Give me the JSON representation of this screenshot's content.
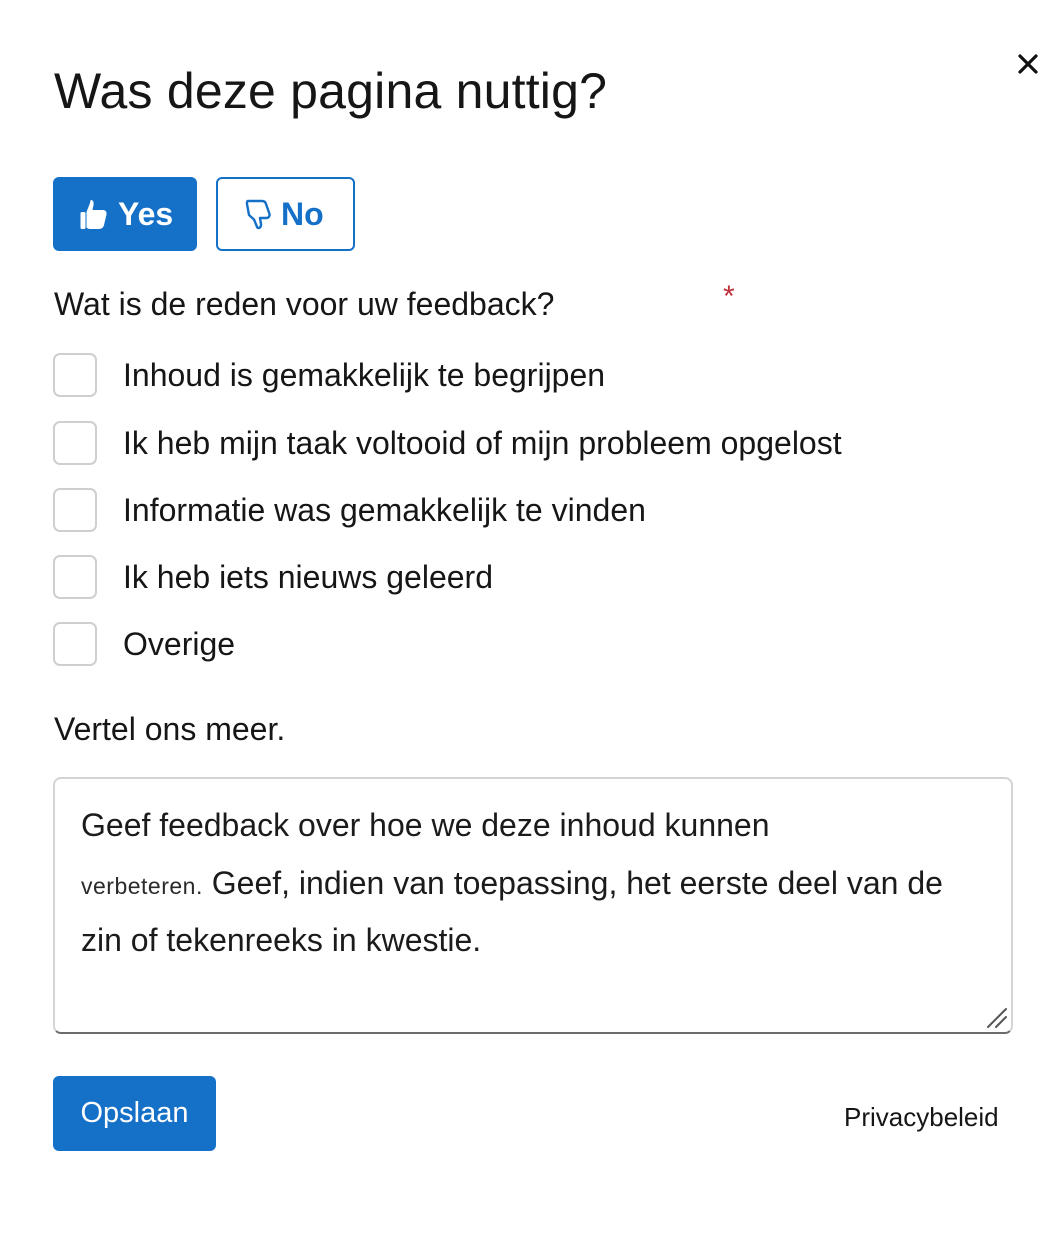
{
  "dialog": {
    "title": "Was deze pagina nuttig?",
    "close_icon": "close-icon"
  },
  "rating": {
    "yes_label": "Yes",
    "yes_icon": "thumbs-up-icon",
    "no_label": "No",
    "no_icon": "thumbs-down-icon",
    "selected": "Yes",
    "accent_color": "#1570c8"
  },
  "reason": {
    "question": "Wat is de reden voor uw feedback?",
    "required_mark": "*",
    "options": [
      {
        "label": "Inhoud is gemakkelijk te begrijpen",
        "checked": false
      },
      {
        "label": "Ik heb mijn taak voltooid of mijn probleem opgelost",
        "checked": false
      },
      {
        "label": "Informatie was gemakkelijk te vinden",
        "checked": false
      },
      {
        "label": "Ik heb iets nieuws geleerd",
        "checked": false
      },
      {
        "label": "Overige",
        "checked": false
      }
    ]
  },
  "details": {
    "label": "Vertel ons meer.",
    "placeholder_line1": "Geef feedback over hoe we deze inhoud kunnen",
    "placeholder_line2a": "verbeteren.",
    "placeholder_line2b": "Geef, indien van toepassing, het eerste deel van de",
    "placeholder_line3": "zin of tekenreeks in kwestie.",
    "resize_icon": "resize-grip-icon"
  },
  "footer": {
    "save_label": "Opslaan",
    "privacy_label": "Privacybeleid"
  }
}
